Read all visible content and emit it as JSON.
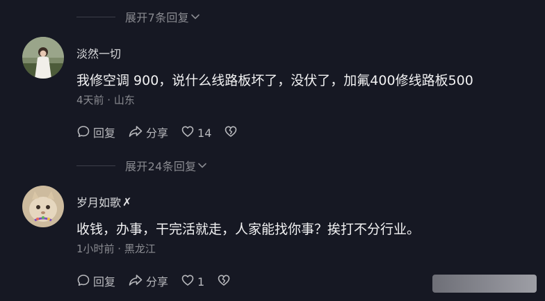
{
  "thread": {
    "expand_1": "展开7条回复",
    "expand_2": "展开24条回复"
  },
  "comments": [
    {
      "username": "淡然一切",
      "text": "我修空调 900，说什么线路板坏了，没伏了，加氟400修线路板500",
      "meta": "4天前 · 山东",
      "reply_label": "回复",
      "share_label": "分享",
      "like_count": "14"
    },
    {
      "username": "岁月如歌",
      "username_mark": "✗",
      "text": "收钱，办事，干完活就走，人家能找你事？挨打不分行业。",
      "meta": "1小时前 · 黑龙江",
      "reply_label": "回复",
      "share_label": "分享",
      "like_count": "1"
    }
  ],
  "icons": {
    "reply": "comment-bubble-icon",
    "share": "share-arrow-icon",
    "like": "heart-icon",
    "dislike": "broken-heart-icon",
    "expand": "chevron-down-icon"
  },
  "colors": {
    "background": "#161823",
    "secondary_text": "#8a8b91",
    "primary_text": "#f2f2f3"
  }
}
